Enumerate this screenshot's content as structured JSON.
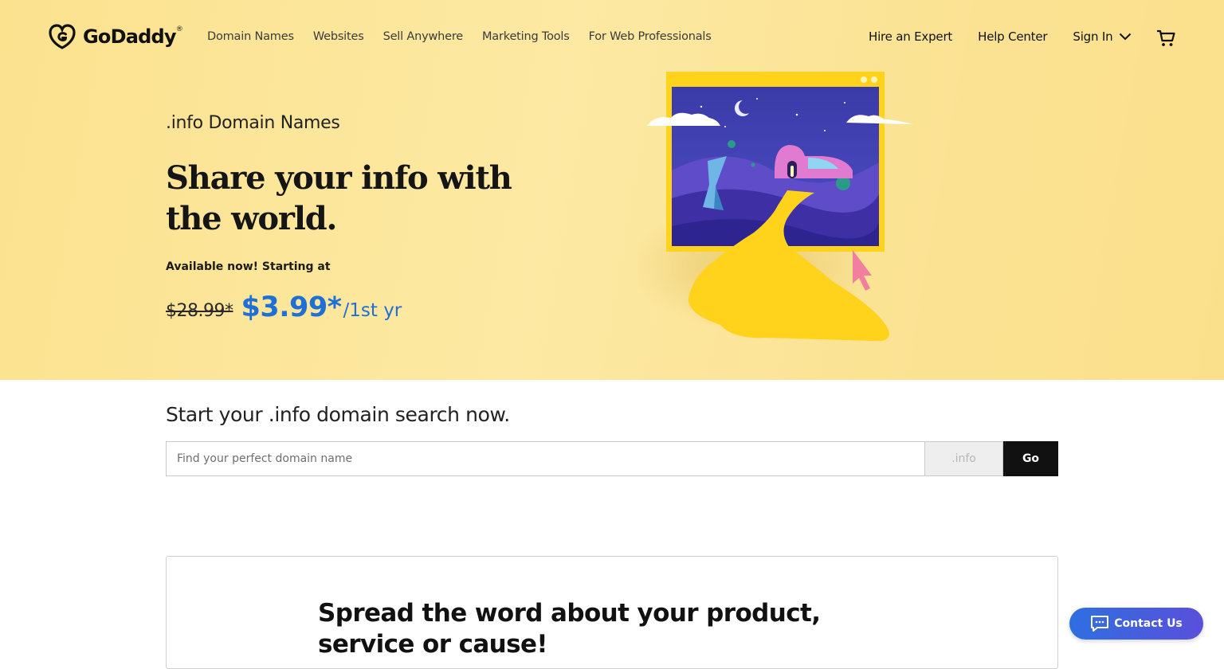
{
  "brand": {
    "name": "GoDaddy",
    "trademark": "®",
    "logo_icon": "godaddy-heart-logo"
  },
  "nav": {
    "primary": [
      "Domain Names",
      "Websites",
      "Sell Anywhere",
      "Marketing Tools",
      "For Web Professionals"
    ],
    "hire_expert": "Hire an Expert",
    "help_center": "Help Center",
    "sign_in": "Sign In",
    "sign_in_icon": "chevron-down-icon",
    "cart_icon": "cart-icon"
  },
  "hero": {
    "eyebrow": ".info Domain Names",
    "headline": "Share your info with the world.",
    "availability": "Available now! Starting at",
    "old_price": "$28.99*",
    "new_price": "$3.99*",
    "term": "/1st yr",
    "illustration": "browser-window-night-landscape-illustration",
    "background_color": "#fbe393"
  },
  "search": {
    "title": "Start your .info domain search now.",
    "placeholder": "Find your perfect domain name",
    "value": "",
    "tld": ".info",
    "button_label": "Go"
  },
  "card": {
    "heading": "Spread the word about your product, service or cause!"
  },
  "contact": {
    "label": "Contact Us",
    "icon": "chat-bubble-icon"
  },
  "colors": {
    "accent": "#1f6fd6",
    "button": "#111111",
    "contact_gradient": [
      "#2f6fe0",
      "#5a4fdc"
    ]
  }
}
